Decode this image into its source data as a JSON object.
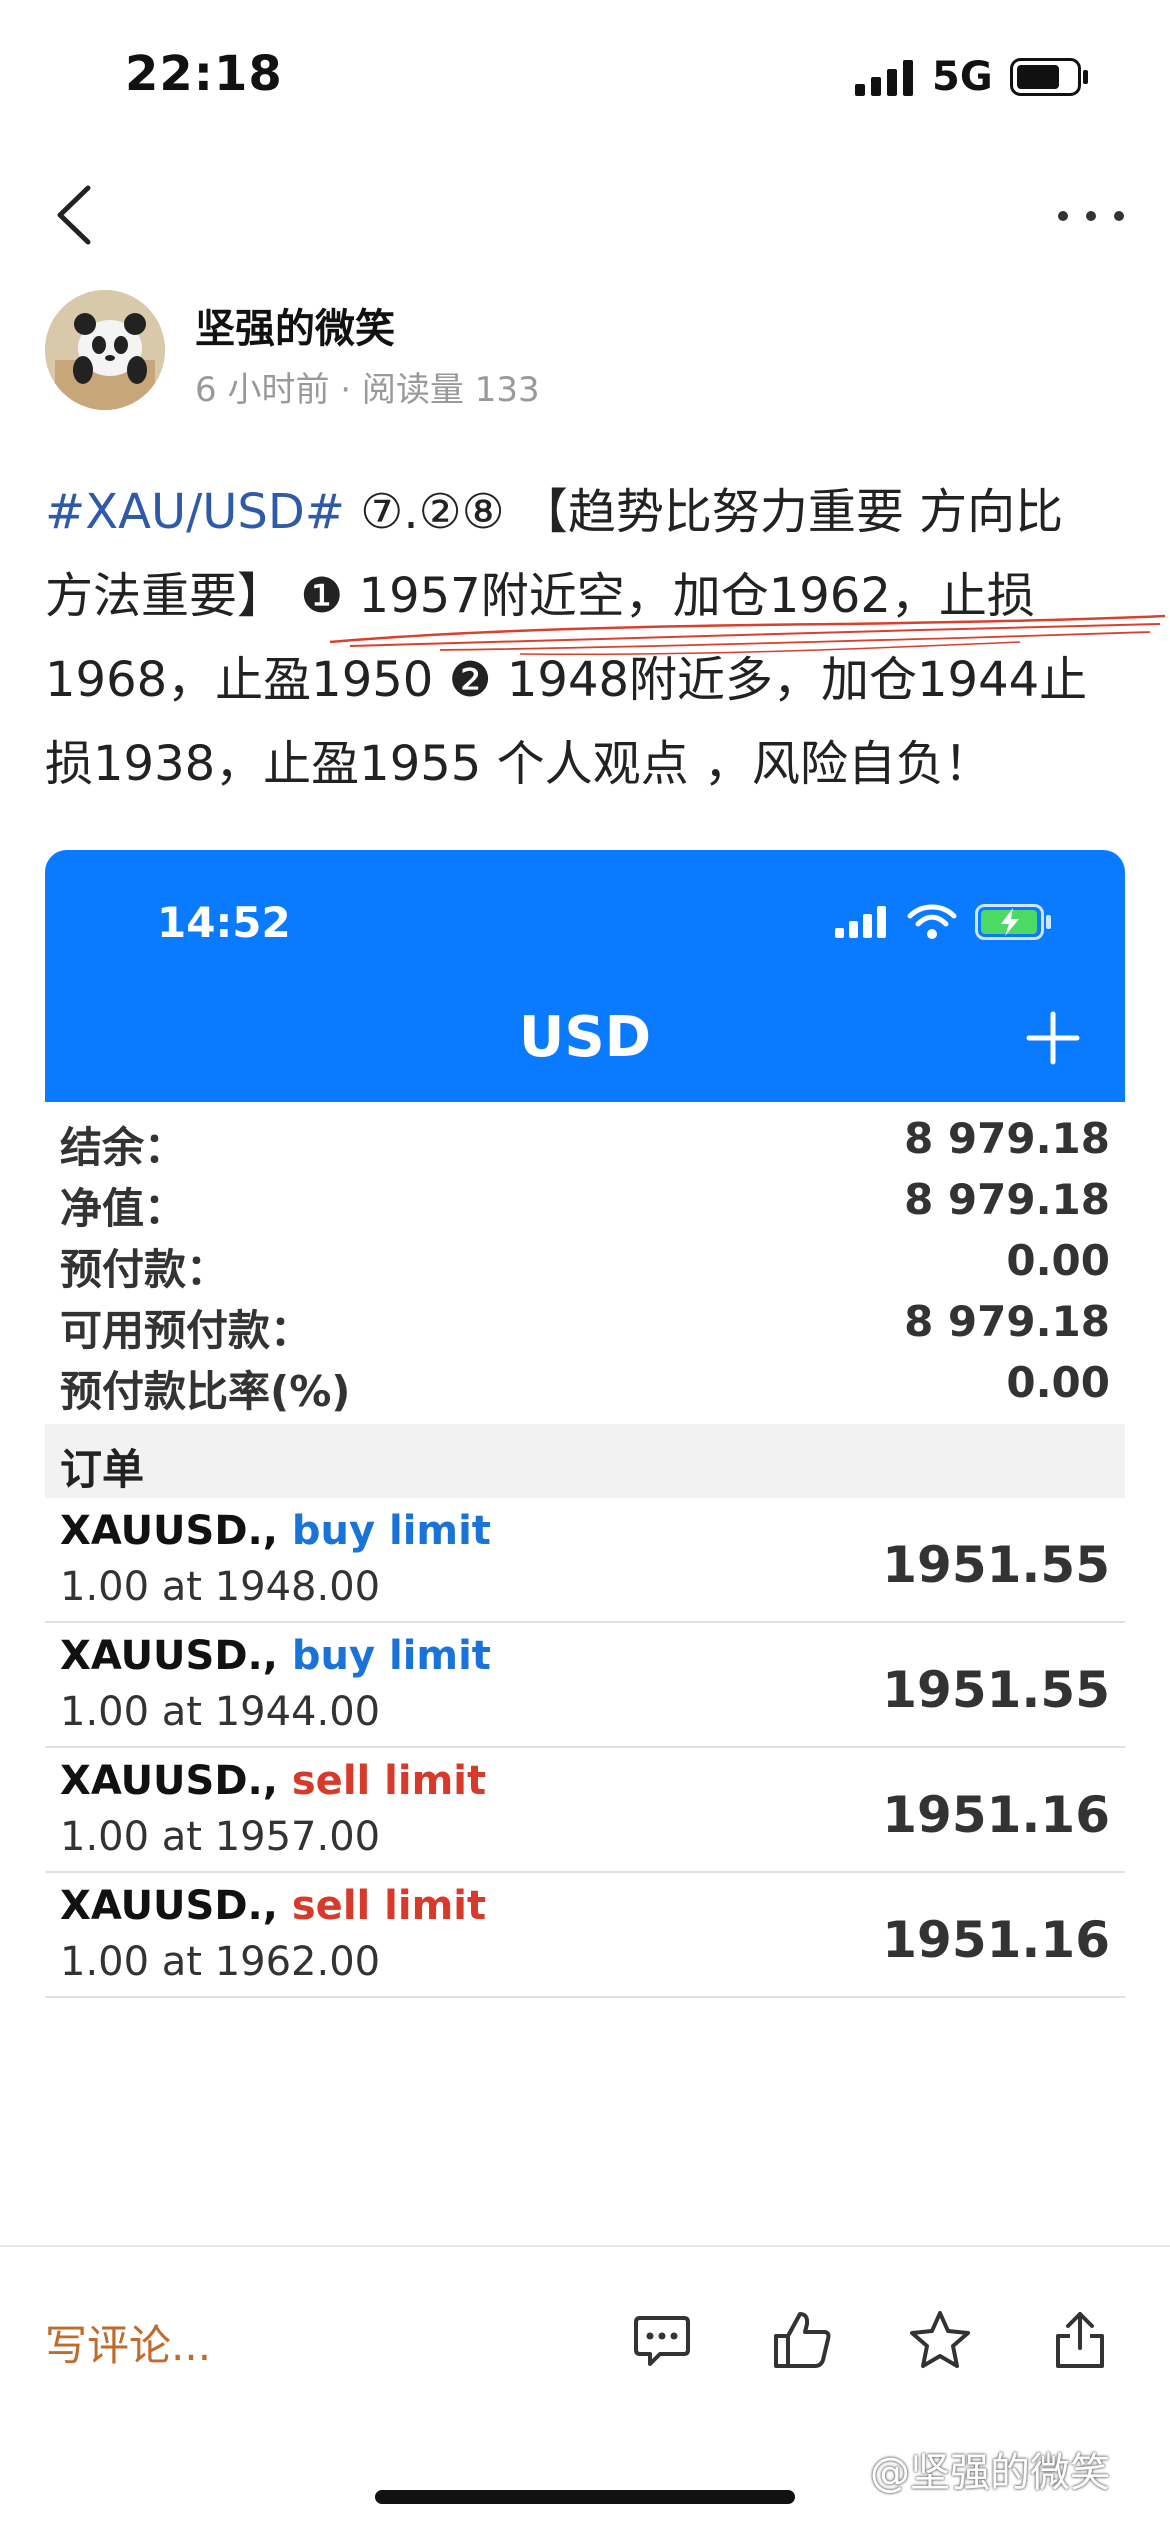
{
  "status_bar": {
    "time": "22:18",
    "network": "5G"
  },
  "nav": {
    "back": "back",
    "more": "more"
  },
  "author": {
    "name": "坚强的微笑",
    "time_ago": "6 小时前",
    "separator": "·",
    "read_count": "阅读量 133"
  },
  "post": {
    "line1_tag": "#XAU/USD#",
    "line1_rest": " ⑦.②⑧ 【趋势比努力重要 方向比",
    "line2": "方法重要】 ❶ 1957附近空，加仓1962，止损",
    "line3": "1968，止盈1950 ❷ 1948附近多，加仓1944止",
    "line4": "损1938，止盈1955 个人观点 ，风险自负！"
  },
  "embed": {
    "time": "14:52",
    "title": "USD",
    "account": [
      {
        "label": "结余：",
        "value": "8 979.18"
      },
      {
        "label": "净值：",
        "value": "8 979.18"
      },
      {
        "label": "预付款：",
        "value": "0.00"
      },
      {
        "label": "可用预付款：",
        "value": "8 979.18"
      },
      {
        "label": "预付款比率(%)",
        "value": "0.00"
      }
    ],
    "orders_header": "订单",
    "orders": [
      {
        "symbol": "XAUUSD.,",
        "type": "buy limit",
        "detail": "1.00 at 1948.00",
        "price": "1951.55"
      },
      {
        "symbol": "XAUUSD.,",
        "type": "buy limit",
        "detail": "1.00 at 1944.00",
        "price": "1951.55"
      },
      {
        "symbol": "XAUUSD.,",
        "type": "sell limit",
        "detail": "1.00 at 1957.00",
        "price": "1951.16"
      },
      {
        "symbol": "XAUUSD.,",
        "type": "sell limit",
        "detail": "1.00 at 1962.00",
        "price": "1951.16"
      }
    ],
    "colors": {
      "header_bg": "#0a7aff",
      "buy": "#1a73d8",
      "sell": "#d73a2a"
    }
  },
  "bottom_bar": {
    "comment_placeholder": "写评论...",
    "icons": [
      "comment-icon",
      "like-icon",
      "star-icon",
      "share-icon"
    ]
  },
  "watermark": "@坚强的微笑",
  "colors": {
    "tag": "#2f5aa8",
    "comment_placeholder": "#c06a2b"
  }
}
